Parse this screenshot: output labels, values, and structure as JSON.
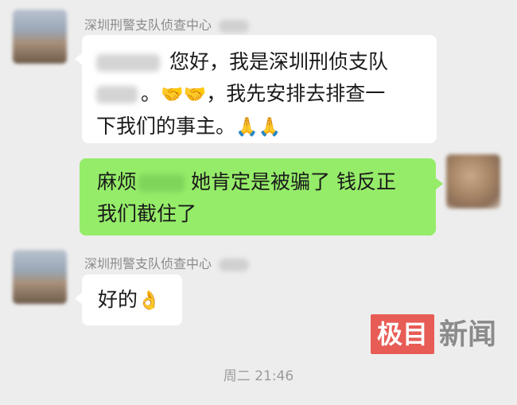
{
  "messages": [
    {
      "sender": "深圳刑警支队侦查中心",
      "sender_suffix_hidden": "李亮",
      "side": "left",
      "lines": [
        {
          "text": "您好，我是深圳刑侦支队",
          "emoji": ""
        },
        {
          "text": "。",
          "emoji": "🤝🤝",
          "rest": "，我先安排去排查一"
        },
        {
          "text": "下我们的事主。",
          "emoji": "🙏🙏"
        }
      ]
    },
    {
      "side": "right",
      "line1_prefix": "麻烦",
      "line1_suffix": "她肯定是被骗了 钱反正",
      "line2": "我们截住了"
    },
    {
      "sender": "深圳刑警支队侦查中心",
      "sender_suffix_hidden": "李亮",
      "side": "left",
      "text": "好的",
      "emoji": "👌"
    }
  ],
  "timestamp": "周二 21:46",
  "watermark": {
    "box": "极目",
    "text": "新闻"
  }
}
